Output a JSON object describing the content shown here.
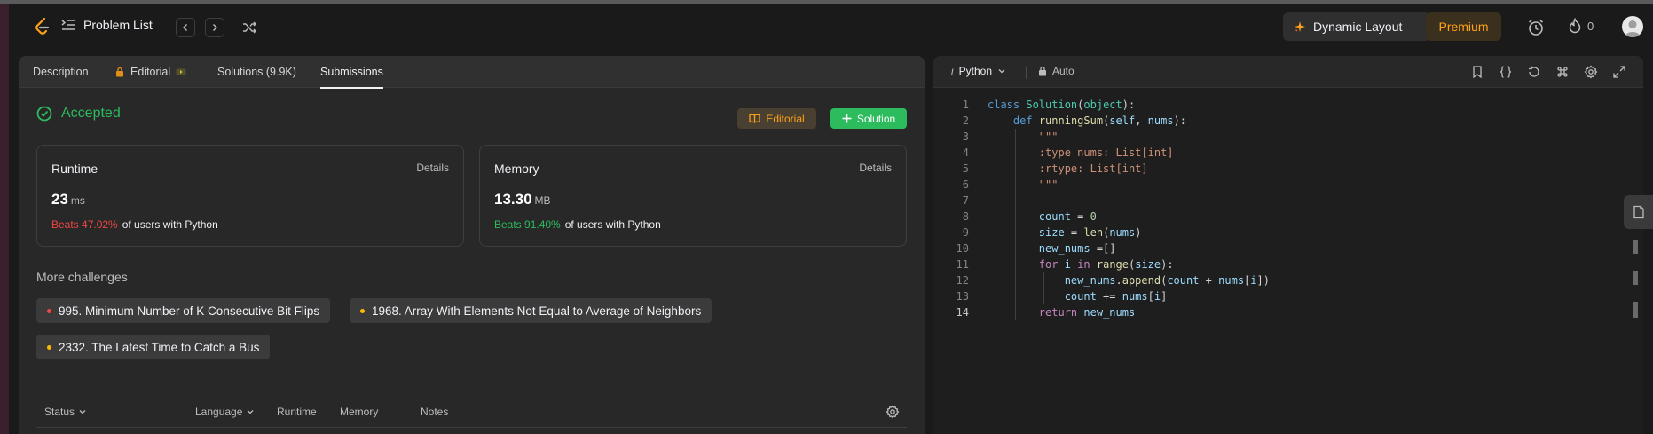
{
  "navbar": {
    "problem_list": "Problem List",
    "dynamic_layout": "Dynamic Layout",
    "premium": "Premium",
    "streak_count": "0"
  },
  "tabs": [
    {
      "label": "Description"
    },
    {
      "label": "Editorial"
    },
    {
      "label": "Solutions (9.9K)"
    },
    {
      "label": "Submissions"
    }
  ],
  "result": {
    "status": "Accepted",
    "editorial_button": "Editorial",
    "solution_button": "Solution"
  },
  "runtime": {
    "title": "Runtime",
    "details": "Details",
    "value": "23",
    "unit": "ms",
    "beats": "Beats 47.02%",
    "beats_suffix": "of users with Python"
  },
  "memory": {
    "title": "Memory",
    "details": "Details",
    "value": "13.30",
    "unit": "MB",
    "beats": "Beats 91.40%",
    "beats_suffix": "of users with Python"
  },
  "more_challenges": {
    "heading": "More challenges",
    "items": [
      {
        "label": "995. Minimum Number of K Consecutive Bit Flips",
        "color": "#ef4743"
      },
      {
        "label": "1968. Array With Elements Not Equal to Average of Neighbors",
        "color": "#ffb800"
      },
      {
        "label": "2332. The Latest Time to Catch a Bus",
        "color": "#ffb800"
      }
    ]
  },
  "table": {
    "columns": [
      "Status",
      "Language",
      "Runtime",
      "Memory",
      "Notes"
    ]
  },
  "editor": {
    "language": "Python",
    "mode": "Auto",
    "line_numbers": [
      "1",
      "2",
      "3",
      "4",
      "5",
      "6",
      "7",
      "8",
      "9",
      "10",
      "11",
      "12",
      "13",
      "14"
    ],
    "code_lines": [
      "class Solution(object):",
      "    def runningSum(self, nums):",
      "        \"\"\"",
      "        :type nums: List[int]",
      "        :rtype: List[int]",
      "        \"\"\"",
      "",
      "        count = 0",
      "        size = len(nums)",
      "        new_nums =[]",
      "        for i in range(size):",
      "            new_nums.append(count + nums[i])",
      "            count += nums[i]",
      "        return new_nums"
    ]
  },
  "colors": {
    "accent_orange": "#ffa116",
    "accepted_green": "#2cbb5d",
    "beats_red": "#ef4743"
  }
}
